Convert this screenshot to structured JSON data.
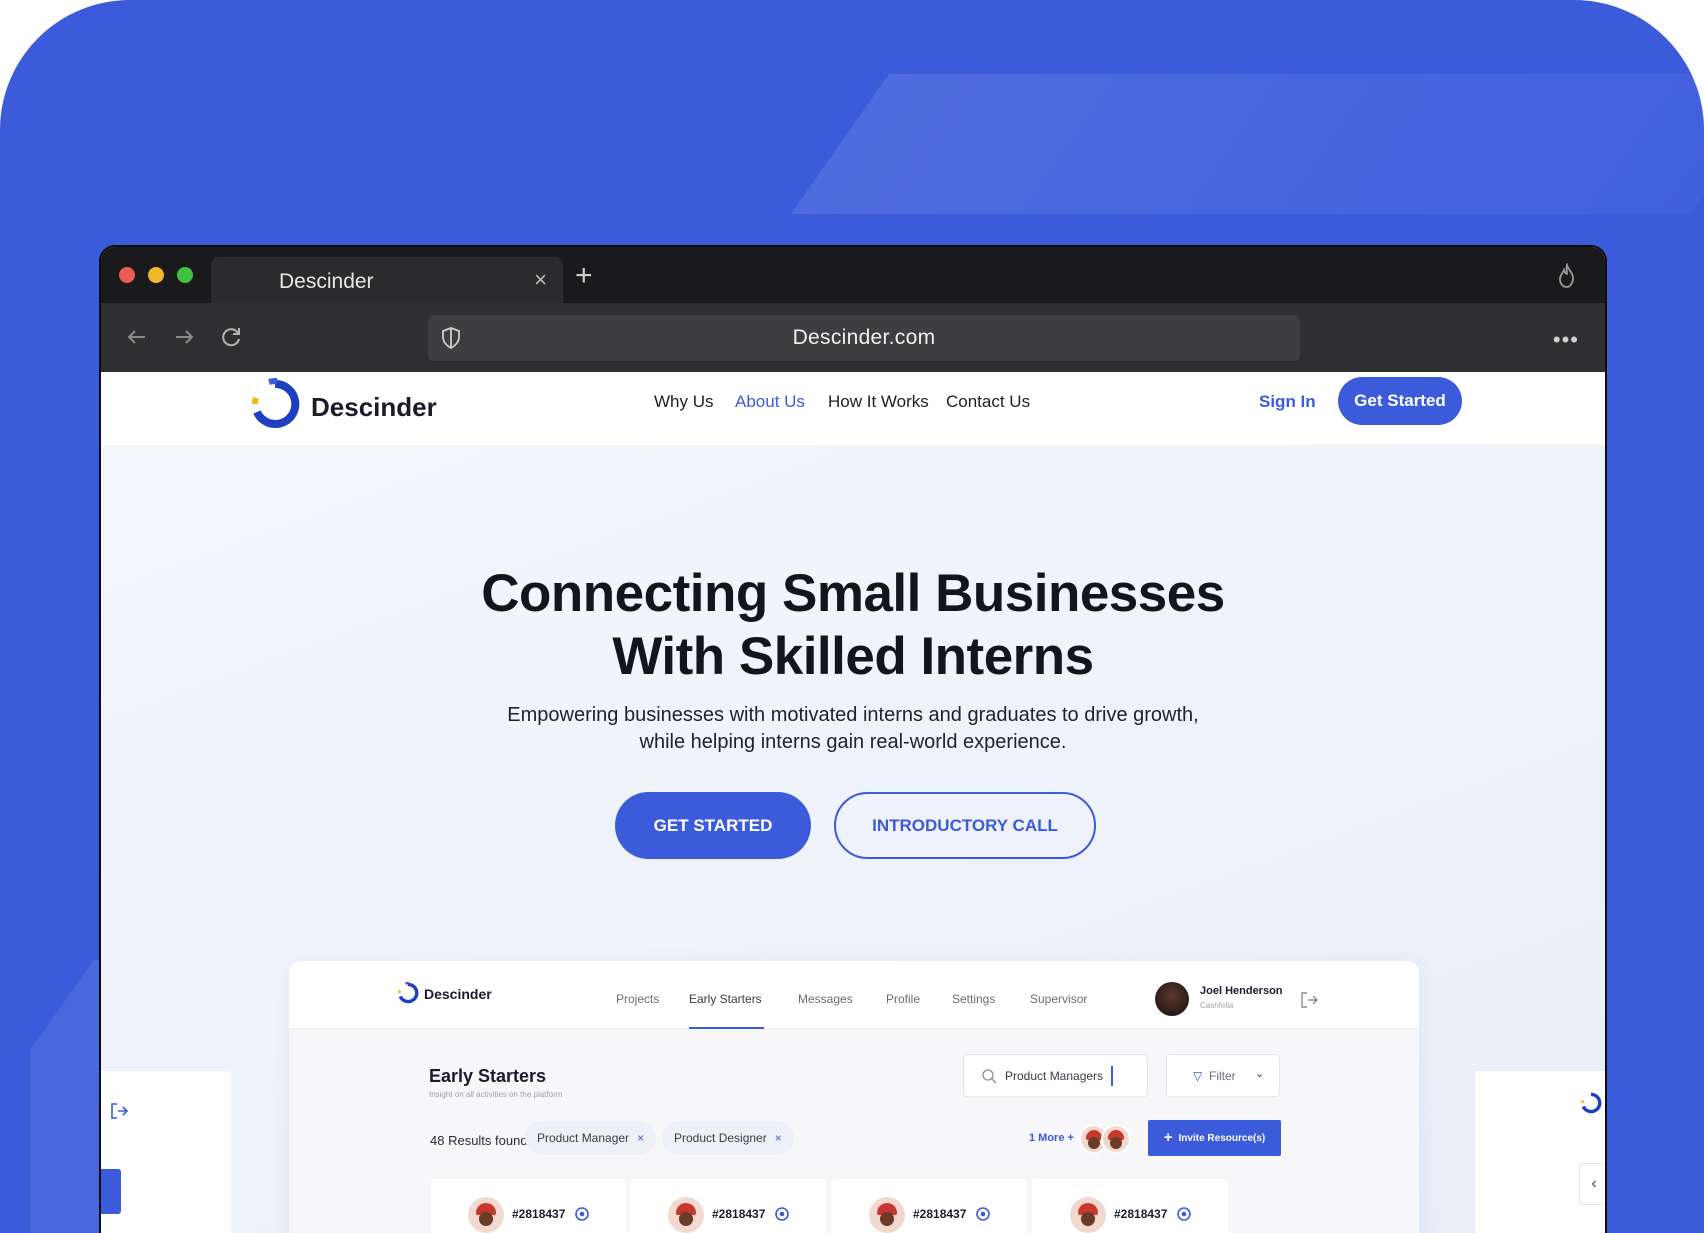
{
  "browser": {
    "tab_title": "Descinder",
    "tab_close": "×",
    "new_tab": "+",
    "url": "Descinder.com",
    "more": "•••"
  },
  "site": {
    "brand": "Descinder",
    "nav": [
      {
        "label": "Why Us",
        "active": false
      },
      {
        "label": "About Us",
        "active": true
      },
      {
        "label": "How It Works",
        "active": false
      },
      {
        "label": "Contact Us",
        "active": false
      }
    ],
    "sign_in": "Sign In",
    "get_started": "Get Started",
    "accent_color": "#3b5bdb"
  },
  "hero": {
    "title_line1": "Connecting Small Businesses",
    "title_line2": "With Skilled Interns",
    "subtitle": "Empowering businesses with motivated interns and graduates to drive growth, while helping interns gain real-world experience.",
    "cta_primary": "GET STARTED",
    "cta_secondary": "INTRODUCTORY CALL"
  },
  "dashboard": {
    "brand": "Descinder",
    "nav": [
      "Projects",
      "Early Starters",
      "Messages",
      "Profile",
      "Settings",
      "Supervisor"
    ],
    "active_nav": "Early Starters",
    "user": {
      "name": "Joel Henderson",
      "role": "Cashfella"
    },
    "title": "Early Starters",
    "subtitle": "Insight on all activities on the platform",
    "search_value": "Product Managers",
    "filter_label": "Filter",
    "results": "48 Results found",
    "chips": [
      "Product Manager",
      "Product Designer"
    ],
    "chip_remove": "×",
    "more_link": "1 More +",
    "invite_plus": "+",
    "invite_label": "Invite Resource(s)",
    "cards": [
      {
        "id": "#2818437"
      },
      {
        "id": "#2818437"
      },
      {
        "id": "#2818437"
      },
      {
        "id": "#2818437"
      }
    ]
  },
  "side_panel": {
    "collapse_icon": "‹"
  }
}
